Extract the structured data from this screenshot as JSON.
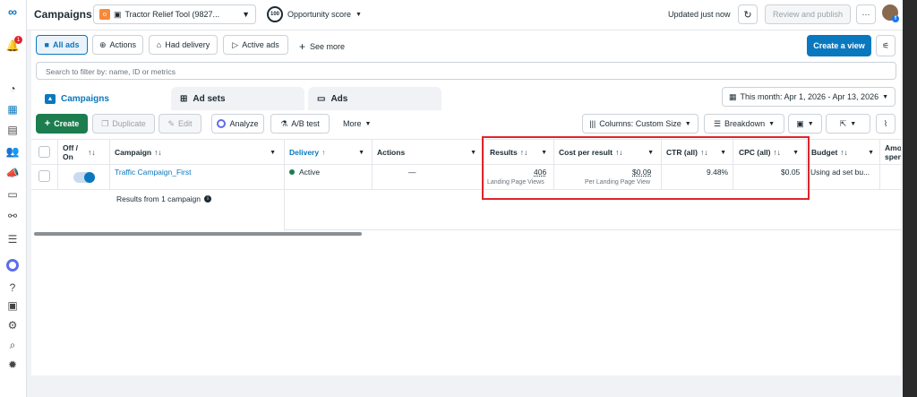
{
  "topbar": {
    "title": "Campaigns",
    "account": "Tractor Relief Tool (9827...",
    "opportunity_badge": "100",
    "opportunity_label": "Opportunity score",
    "updated": "Updated just now",
    "review_publish": "Review and publish",
    "more": "···"
  },
  "filters": {
    "all_ads": "All ads",
    "actions": "Actions",
    "had_delivery": "Had delivery",
    "active_ads": "Active ads",
    "see_more": "See more",
    "create_view": "Create a view"
  },
  "search": {
    "placeholder": "Search to filter by: name, ID or metrics"
  },
  "tabs": {
    "campaigns": "Campaigns",
    "ad_sets": "Ad sets",
    "ads": "Ads"
  },
  "date_range": "This month: Apr 1, 2026 - Apr 13, 2026",
  "toolbar": {
    "create": "Create",
    "duplicate": "Duplicate",
    "edit": "Edit",
    "analyze": "Analyze",
    "ab_test": "A/B test",
    "more": "More",
    "columns": "Columns: Custom Size",
    "breakdown": "Breakdown"
  },
  "table": {
    "headers": {
      "offon": "Off / On",
      "campaign": "Campaign",
      "delivery": "Delivery",
      "actions": "Actions",
      "results": "Results",
      "cpr": "Cost per result",
      "ctr": "CTR (all)",
      "cpc": "CPC (all)",
      "budget": "Budget",
      "amount": "Amo spen"
    },
    "row": {
      "campaign": "Traffic Campaign_First",
      "delivery": "Active",
      "actions": "—",
      "results": "406",
      "results_sub": "Landing Page Views",
      "cpr": "$0.09",
      "cpr_sub": "Per Landing Page View",
      "ctr": "9.48%",
      "cpc": "$0.05",
      "budget": "Using ad set bu..."
    },
    "summary": "Results from 1 campaign"
  },
  "colors": {
    "accent": "#0a78be",
    "create": "#1d7d4f",
    "highlight": "#e0242b",
    "active_dot": "#1d7d4f"
  }
}
